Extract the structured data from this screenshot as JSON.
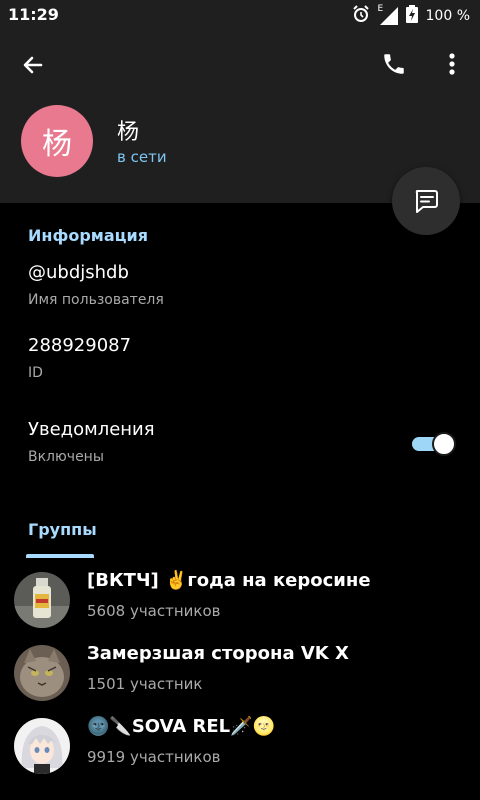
{
  "status_bar": {
    "time": "11:29",
    "network_label": "E",
    "battery_percent": "100 %",
    "icons": [
      "alarm-icon",
      "signal-icon",
      "battery-charging-icon"
    ]
  },
  "toolbar": {
    "back_icon": "arrow-left-icon",
    "call_icon": "phone-icon",
    "more_icon": "more-vertical-icon"
  },
  "profile": {
    "avatar_letter": "杨",
    "avatar_color": "#e8798f",
    "name": "杨",
    "status": "в сети",
    "fab_icon": "message-icon"
  },
  "info": {
    "section_title": "Информация",
    "username": "@ubdjshdb",
    "username_label": "Имя пользователя",
    "id": "288929087",
    "id_label": "ID",
    "notifications_title": "Уведомления",
    "notifications_state": "Включены",
    "notifications_enabled": true
  },
  "tabs": {
    "groups_label": "Группы"
  },
  "groups": [
    {
      "title": "[ВКТЧ] ✌️года на керосине",
      "members": "5608 участников",
      "avatar": "bottle-photo"
    },
    {
      "title": "Замерзшая сторона VK X",
      "members": "1501 участник",
      "avatar": "cat-photo"
    },
    {
      "title": "🌚🔪SOVA REL🗡️🌝",
      "members": "9919 участников",
      "avatar": "anime-girl-photo"
    }
  ],
  "colors": {
    "accent": "#a8dbff",
    "online": "#7ec6f2",
    "header_bg": "#1f1f1f",
    "page_bg": "#000000"
  }
}
